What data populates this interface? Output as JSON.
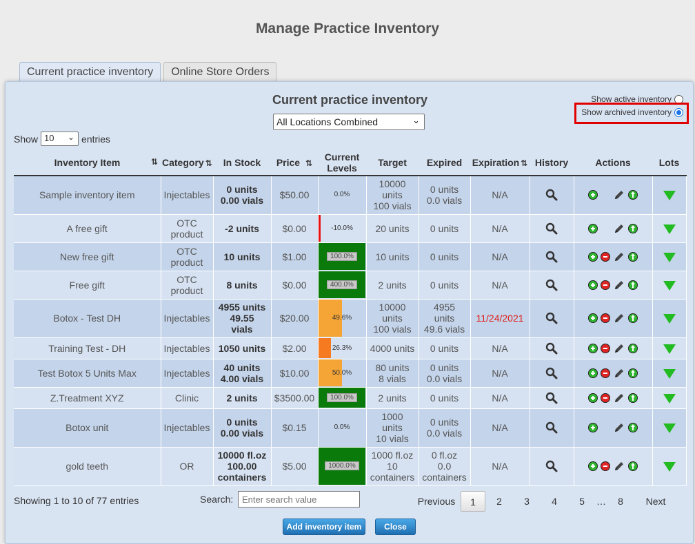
{
  "page_title": "Manage Practice Inventory",
  "tabs": [
    {
      "label": "Current practice inventory",
      "active": true
    },
    {
      "label": "Online Store Orders",
      "active": false
    }
  ],
  "panel": {
    "title": "Current practice inventory",
    "location_select": "All Locations Combined",
    "radio_active": "Show active inventory",
    "radio_archived": "Show archived inventory",
    "selected_radio": "archived"
  },
  "show_entries": {
    "show": "Show",
    "value": "10",
    "entries": "entries"
  },
  "columns": [
    "Inventory Item",
    "Category",
    "In Stock",
    "Price",
    "Current Levels",
    "Target",
    "Expired",
    "Expiration",
    "History",
    "Actions",
    "Lots"
  ],
  "rows": [
    {
      "item": "Sample inventory item",
      "category": "Injectables",
      "stock": [
        "0 units",
        "0.00 vials"
      ],
      "price": "$50.00",
      "level_label": "0.0%",
      "level": 0,
      "level_color": "none",
      "target": [
        "10000",
        "units",
        "100 vials"
      ],
      "expired": [
        "0 units",
        "0.0 vials"
      ],
      "expiration": "N/A",
      "exp_red": false,
      "remove": false
    },
    {
      "item": "A free gift",
      "category": [
        "OTC",
        "product"
      ],
      "stock": [
        "-2 units"
      ],
      "price": "$0.00",
      "level_label": "-10.0%",
      "level": -10,
      "level_color": "#e81010",
      "target": [
        "20 units"
      ],
      "expired": [
        "0 units"
      ],
      "expiration": "N/A",
      "exp_red": false,
      "remove": false
    },
    {
      "item": "New free gift",
      "category": [
        "OTC",
        "product"
      ],
      "stock": [
        "10 units"
      ],
      "price": "$1.00",
      "level_label": "100.0%",
      "level": 100,
      "level_color": "#0a7a0a",
      "target": [
        "10 units"
      ],
      "expired": [
        "0 units"
      ],
      "expiration": "N/A",
      "exp_red": false,
      "remove": true
    },
    {
      "item": "Free gift",
      "category": [
        "OTC",
        "product"
      ],
      "stock": [
        "8 units"
      ],
      "price": "$0.00",
      "level_label": "400.0%",
      "level": 400,
      "level_color": "#0a7a0a",
      "target": [
        "2 units"
      ],
      "expired": [
        "0 units"
      ],
      "expiration": "N/A",
      "exp_red": false,
      "remove": true
    },
    {
      "item": "Botox - Test DH",
      "category": "Injectables",
      "stock": [
        "4955 units",
        "49.55",
        "vials"
      ],
      "price": "$20.00",
      "level_label": "49.6%",
      "level": 49.6,
      "level_color": "#f5a535",
      "target": [
        "10000",
        "units",
        "100 vials"
      ],
      "expired": [
        "4955",
        "units",
        "49.6 vials"
      ],
      "expiration": "11/24/2021",
      "exp_red": true,
      "remove": true
    },
    {
      "item": "Training Test - DH",
      "category": "Injectables",
      "stock": [
        "1050 units"
      ],
      "price": "$2.00",
      "level_label": "26.3%",
      "level": 26.3,
      "level_color": "#f57a20",
      "target": [
        "4000 units"
      ],
      "expired": [
        "0 units"
      ],
      "expiration": "N/A",
      "exp_red": false,
      "remove": true
    },
    {
      "item": "Test Botox 5 Units Max",
      "category": "Injectables",
      "stock": [
        "40 units",
        "4.00 vials"
      ],
      "price": "$10.00",
      "level_label": "50.0%",
      "level": 50,
      "level_color": "#f5a535",
      "target": [
        "80 units",
        "8 vials"
      ],
      "expired": [
        "0 units",
        "0.0 vials"
      ],
      "expiration": "N/A",
      "exp_red": false,
      "remove": true
    },
    {
      "item": "Z.Treatment XYZ",
      "category": "Clinic",
      "stock": [
        "2 units"
      ],
      "price": "$3500.00",
      "level_label": "100.0%",
      "level": 100,
      "level_color": "#0a7a0a",
      "target": [
        "2 units"
      ],
      "expired": [
        "0 units"
      ],
      "expiration": "N/A",
      "exp_red": false,
      "remove": true
    },
    {
      "item": "Botox unit",
      "category": "Injectables",
      "stock": [
        "0 units",
        "0.00 vials"
      ],
      "price": "$0.15",
      "level_label": "0.0%",
      "level": 0,
      "level_color": "none",
      "target": [
        "1000",
        "units",
        "10 vials"
      ],
      "expired": [
        "0 units",
        "0.0 vials"
      ],
      "expiration": "N/A",
      "exp_red": false,
      "remove": false
    },
    {
      "item": "gold teeth",
      "category": "OR",
      "stock": [
        "10000 fl.oz",
        "100.00",
        "containers"
      ],
      "price": "$5.00",
      "level_label": "1000.0%",
      "level": 1000,
      "level_color": "#0a7a0a",
      "target": [
        "1000 fl.oz",
        "10",
        "containers"
      ],
      "expired": [
        "0 fl.oz",
        "0.0",
        "containers"
      ],
      "expiration": "N/A",
      "exp_red": false,
      "remove": true
    }
  ],
  "footer": {
    "info": "Showing 1 to 10 of 77 entries",
    "search_label": "Search:",
    "search_placeholder": "Enter search value",
    "pagination": {
      "previous": "Previous",
      "pages": [
        "1",
        "2",
        "3",
        "4",
        "5"
      ],
      "ellipsis": "…",
      "last": "8",
      "next": "Next",
      "current": "1"
    }
  },
  "buttons": {
    "add": "Add inventory item",
    "close": "Close"
  },
  "icons": {
    "history": "magnifier-icon",
    "add": "plus-circle-icon",
    "remove": "minus-circle-icon",
    "edit": "pencil-icon",
    "upload": "arrow-up-circle-icon",
    "lots": "triangle-down-icon"
  }
}
